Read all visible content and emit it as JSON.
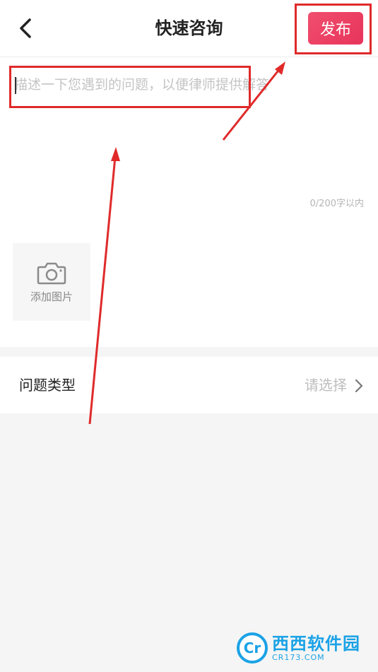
{
  "header": {
    "back_icon": "chevron-left-icon",
    "title": "快速咨询",
    "publish_label": "发布"
  },
  "editor": {
    "placeholder": "描述一下您遇到的问题，以便律师提供解答",
    "value": "",
    "counter": "0/200字以内"
  },
  "add_photo": {
    "icon": "camera-icon",
    "label": "添加图片"
  },
  "question_type": {
    "label": "问题类型",
    "value": "请选择",
    "chevron_icon": "chevron-right-icon"
  },
  "watermark": {
    "logo_text": "Cr",
    "title": "西西软件园",
    "subtitle": "CR173.COM"
  },
  "colors": {
    "publish_gradient_start": "#f04e6e",
    "publish_gradient_end": "#e8345a",
    "annotation_red": "#e02a2a",
    "page_background": "#f5f5f5",
    "watermark_blue": "#1aa2e6"
  }
}
